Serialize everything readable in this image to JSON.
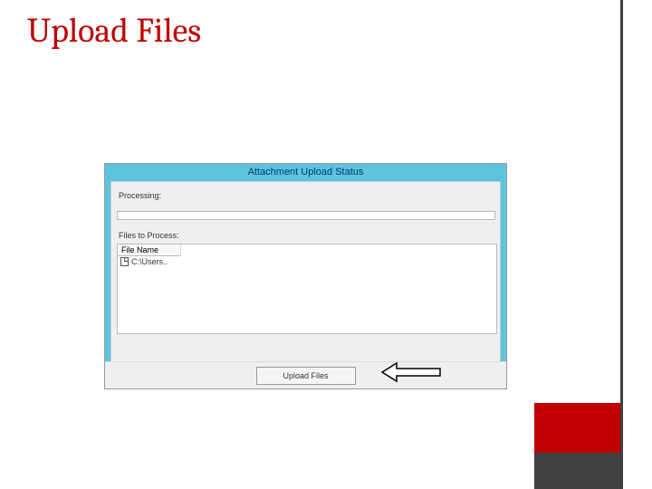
{
  "slide": {
    "title": "Upload Files"
  },
  "dialog": {
    "title": "Attachment Upload Status",
    "processing_label": "Processing:",
    "files_label": "Files to Process:",
    "column_header": "File Name",
    "rows": [
      {
        "name": "C:\\Users.."
      }
    ],
    "upload_button": "Upload Files"
  }
}
